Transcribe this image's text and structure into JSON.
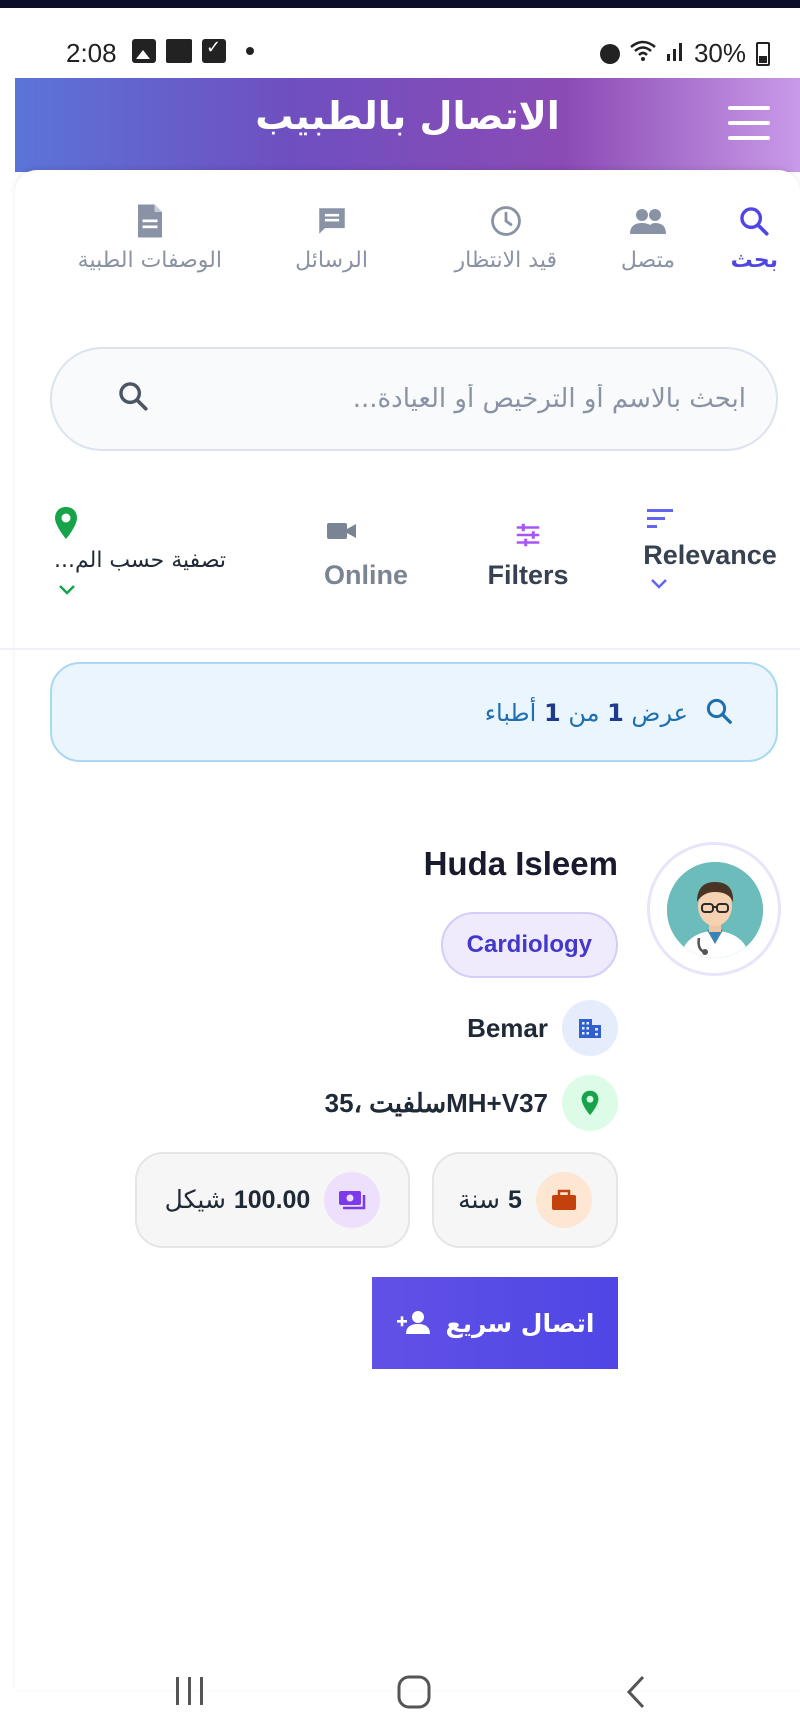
{
  "status_bar": {
    "time": "2:08",
    "battery": "30%",
    "icons": [
      "gallery-icon",
      "device-icon",
      "checkbox-icon",
      "dot-icon",
      "alarm-icon",
      "wifi-icon",
      "signal-icon",
      "battery-icon"
    ]
  },
  "header": {
    "title": "الاتصال بالطبيب",
    "menu_icon": "hamburger-menu-icon"
  },
  "tabs": [
    {
      "label": "بحث",
      "icon": "search-icon",
      "active": true
    },
    {
      "label": "متصل",
      "icon": "people-icon",
      "active": false
    },
    {
      "label": "قيد الانتظار",
      "icon": "clock-icon",
      "active": false
    },
    {
      "label": "الرسائل",
      "icon": "message-icon",
      "active": false
    },
    {
      "label": "الوصفات الطبية",
      "icon": "document-icon",
      "active": false
    }
  ],
  "search": {
    "placeholder": "ابحث بالاسم أو الترخيص أو العيادة...",
    "value": ""
  },
  "filters": {
    "sort": {
      "label": "Relevance",
      "icon": "sort-icon"
    },
    "filters": {
      "label": "Filters",
      "icon": "tune-icon"
    },
    "online": {
      "label": "Online",
      "icon": "video-icon"
    },
    "location": {
      "label": "تصفية حسب الم...",
      "icon": "location-pin-icon"
    }
  },
  "results": {
    "prefix": "عرض",
    "shown": "1",
    "middle": "من",
    "total": "1",
    "suffix": "أطباء"
  },
  "doctor": {
    "name": "Huda Isleem",
    "specialty": "Cardiology",
    "clinic": "Bemar",
    "location": "سلفيت ،35MH+V37",
    "experience": "5 سنة",
    "experience_number": "5",
    "experience_unit": "سنة",
    "fee_amount": "100.00",
    "fee_currency": "شيكل",
    "quick_connect_label": "اتصال سريع"
  },
  "colors": {
    "accent": "#4f46e5",
    "header_gradient_start": "#5b74d8",
    "header_gradient_end": "#c99ae8",
    "banner_bg": "#eaf5fd",
    "location_green": "#16a34a"
  },
  "nav_bar": {
    "icons": [
      "recent-apps-icon",
      "home-icon",
      "back-icon"
    ]
  }
}
